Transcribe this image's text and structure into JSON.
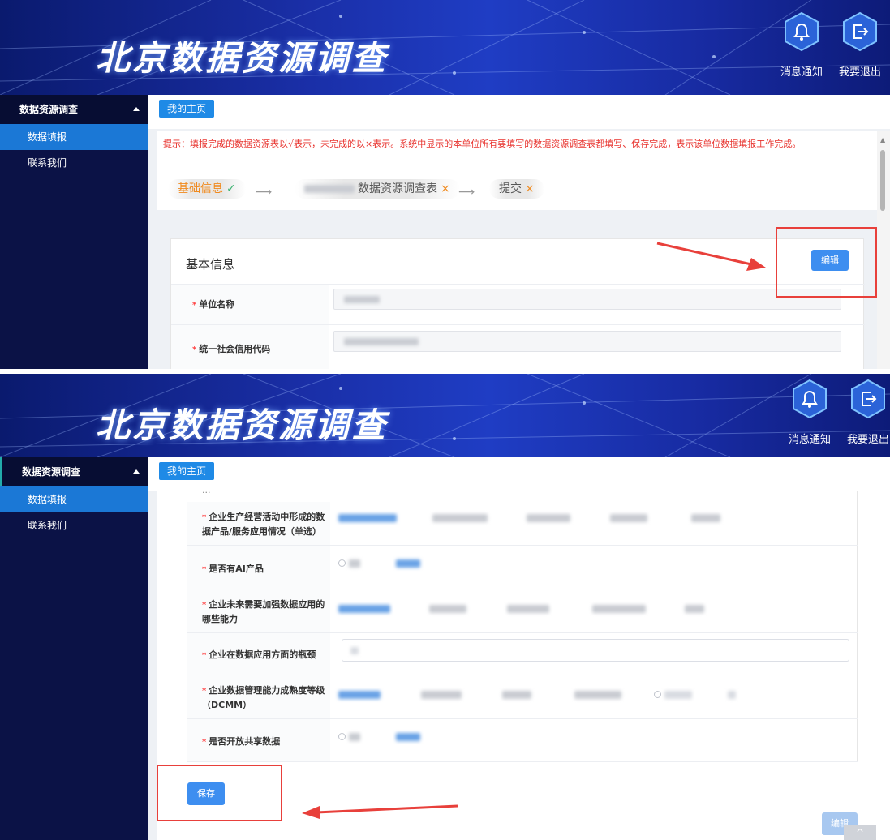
{
  "header": {
    "title": "北京数据资源调查",
    "notify_label": "消息通知",
    "logout_label": "我要退出"
  },
  "sidebar": {
    "section": "数据资源调查",
    "items": [
      {
        "label": "数据填报",
        "active": true
      },
      {
        "label": "联系我们",
        "active": false
      }
    ]
  },
  "tabs": [
    {
      "label": "我的主页"
    }
  ],
  "notice": "提示：填报完成的数据资源表以√表示，未完成的以×表示。系统中显示的本单位所有要填写的数据资源调查表都填写、保存完成，表示该单位数据填报工作完成。",
  "steps": [
    {
      "label": "基础信息",
      "mark": "✓",
      "status": "done"
    },
    {
      "label": "数据资源调查表",
      "mark": "×",
      "status": "todo"
    },
    {
      "label": "提交",
      "mark": "×",
      "status": "todo"
    }
  ],
  "basic_info": {
    "title": "基本信息",
    "edit_label": "编辑",
    "fields": [
      {
        "label": "单位名称"
      },
      {
        "label": "统一社会信用代码"
      }
    ]
  },
  "form2": {
    "rows": [
      {
        "label": "企业生产经营活动中形成的数据产品/服务应用情况（单选）"
      },
      {
        "label": "是否有AI产品"
      },
      {
        "label": "企业未来需要加强数据应用的哪些能力"
      },
      {
        "label": "企业在数据应用方面的瓶颈"
      },
      {
        "label": "企业数据管理能力成熟度等级（DCMM）"
      },
      {
        "label": "是否开放共享数据"
      }
    ],
    "save_label": "保存",
    "edit_label": "编辑",
    "backtop_label": "^"
  },
  "colors": {
    "banner": "#1a2fa8",
    "sidebar": "#0b1246",
    "primary": "#3d8ef0",
    "notice": "#e8332e",
    "highlight": "#e8403b"
  }
}
